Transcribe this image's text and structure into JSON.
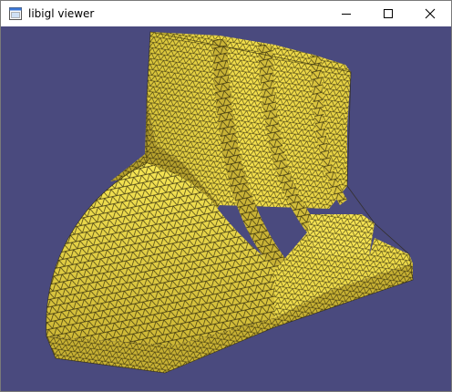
{
  "window": {
    "title": "libigl viewer",
    "app_icon": "window-app-icon",
    "controls": [
      {
        "name": "minimize-button",
        "icon": "minimize-icon"
      },
      {
        "name": "maximize-button",
        "icon": "maximize-icon"
      },
      {
        "name": "close-button",
        "icon": "close-icon"
      }
    ]
  },
  "viewer": {
    "background_color": "#4a4a7e",
    "mesh_color": "#f3df4a",
    "wire_color": "#1e1a06"
  }
}
